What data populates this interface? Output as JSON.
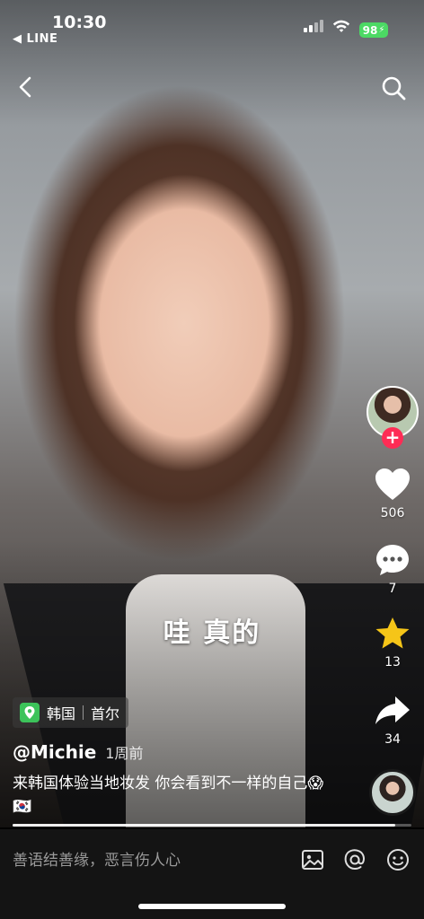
{
  "status_bar": {
    "time": "10:30",
    "back_app": "◀ LINE",
    "battery": "98"
  },
  "video": {
    "subtitle": "哇 真的",
    "progress": 0.96
  },
  "rail": {
    "likes": "506",
    "comments": "7",
    "favorites": "13",
    "shares": "34",
    "favorite_color": "#f5c518",
    "follow_color": "#fe2c55"
  },
  "location": {
    "country": "韩国",
    "city": "首尔"
  },
  "author": {
    "name": "@Michie",
    "posted": "1周前"
  },
  "caption": "来韩国体验当地妆发 你会看到不一样的自己😱 🇰🇷",
  "comment_bar": {
    "placeholder": "善语结善缘，恶言伤人心"
  }
}
